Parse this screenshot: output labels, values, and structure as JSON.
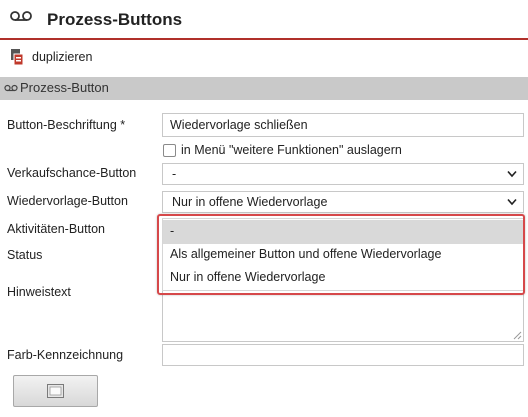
{
  "header": {
    "title": "Prozess-Buttons",
    "icon": "voicemail-icon"
  },
  "toolbar": {
    "duplicate_label": "duplizieren",
    "duplicate_icon": "duplicate-icon"
  },
  "section": {
    "title": "Prozess-Button",
    "icon": "voicemail-icon"
  },
  "form": {
    "button_caption": {
      "label": "Button-Beschriftung *",
      "value": "Wiedervorlage schließen"
    },
    "move_to_more_functions": {
      "label": "in Menü \"weitere Funktionen\" auslagern",
      "checked": false
    },
    "opportunity_button": {
      "label": "Verkaufschance-Button",
      "value": "-"
    },
    "resubmission_button": {
      "label": "Wiedervorlage-Button",
      "value": "Nur in offene Wiedervorlage"
    },
    "activities_button": {
      "label": "Aktivitäten-Button",
      "options": [
        "-",
        "Als allgemeiner Button und offene Wiedervorlage",
        "Nur in offene Wiedervorlage"
      ],
      "highlighted_option": "-"
    },
    "status": {
      "label": "Status"
    },
    "hint_text": {
      "label": "Hinweistext",
      "value": ""
    },
    "color_marking": {
      "label": "Farb-Kennzeichnung",
      "value": ""
    }
  },
  "colors": {
    "accent": "#b0302a",
    "highlight_border": "#d6484a",
    "section_bg": "#c9c9c9"
  }
}
